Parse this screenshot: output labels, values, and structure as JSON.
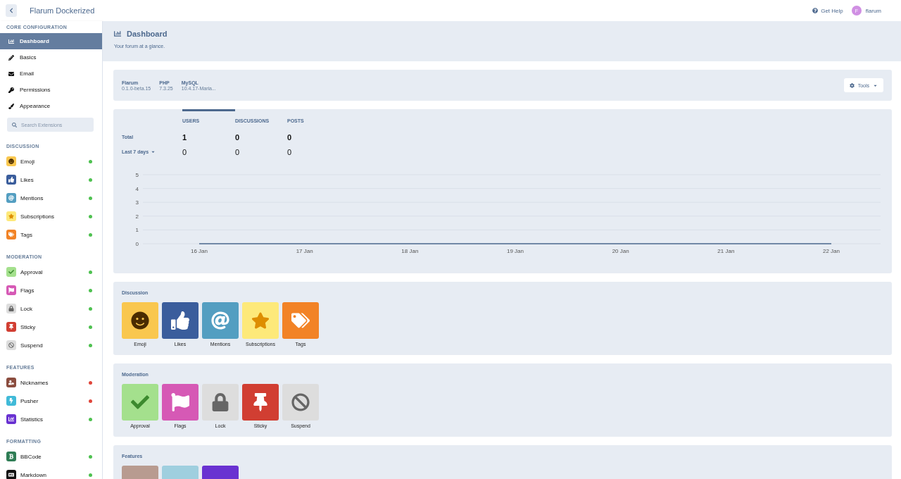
{
  "app": {
    "title": "Flarum Dockerized"
  },
  "header": {
    "help": "Get Help",
    "user": {
      "initial": "F",
      "name": "flarum"
    }
  },
  "sidebar": {
    "core_heading": "CORE CONFIGURATION",
    "core_items": [
      {
        "label": "Dashboard",
        "selected": true
      },
      {
        "label": "Basics",
        "selected": false
      },
      {
        "label": "Email",
        "selected": false
      },
      {
        "label": "Permissions",
        "selected": false
      },
      {
        "label": "Appearance",
        "selected": false
      }
    ],
    "search": {
      "placeholder": "Search Extensions"
    },
    "groups": [
      {
        "heading": "DISCUSSION",
        "items": [
          {
            "label": "Emoji",
            "color": "#4ec150"
          },
          {
            "label": "Likes",
            "color": "#4ec150"
          },
          {
            "label": "Mentions",
            "color": "#4ec150"
          },
          {
            "label": "Subscriptions",
            "color": "#4ec150"
          },
          {
            "label": "Tags",
            "color": "#4ec150"
          }
        ]
      },
      {
        "heading": "MODERATION",
        "items": [
          {
            "label": "Approval",
            "color": "#4ec150"
          },
          {
            "label": "Flags",
            "color": "#4ec150"
          },
          {
            "label": "Lock",
            "color": "#4ec150"
          },
          {
            "label": "Sticky",
            "color": "#4ec150"
          },
          {
            "label": "Suspend",
            "color": "#4ec150"
          }
        ]
      },
      {
        "heading": "FEATURES",
        "items": [
          {
            "label": "Nicknames",
            "color": "#e0453a"
          },
          {
            "label": "Pusher",
            "color": "#e0453a"
          },
          {
            "label": "Statistics",
            "color": "#4ec150"
          }
        ]
      },
      {
        "heading": "FORMATTING",
        "items": [
          {
            "label": "BBCode",
            "color": "#4ec150"
          },
          {
            "label": "Markdown",
            "color": "#4ec150"
          }
        ]
      }
    ]
  },
  "page": {
    "title": "Dashboard",
    "subtitle": "Your forum at a glance."
  },
  "status": {
    "items": [
      {
        "name": "Flarum",
        "value": "0.1.0-beta.15"
      },
      {
        "name": "PHP",
        "value": "7.3.25"
      },
      {
        "name": "MySQL",
        "value": "10.4.17-Maria..."
      }
    ],
    "tools": "Tools"
  },
  "statistics": {
    "columns": [
      {
        "label": "USERS",
        "selected": true
      },
      {
        "label": "DISCUSSIONS",
        "selected": false
      },
      {
        "label": "POSTS",
        "selected": false
      }
    ],
    "rows": [
      {
        "label": "Total",
        "kind": "total",
        "values": [
          "1",
          "0",
          "0"
        ]
      },
      {
        "label": "Last 7 days",
        "kind": "period",
        "values": [
          "0",
          "0",
          "0"
        ]
      }
    ],
    "chart_data": {
      "type": "line",
      "grid": true,
      "categories": [
        "16 Jan",
        "17 Jan",
        "18 Jan",
        "19 Jan",
        "20 Jan",
        "21 Jan",
        "22 Jan"
      ],
      "ylim": [
        0,
        5
      ],
      "yticks": [
        0,
        1,
        2,
        3,
        4,
        5
      ],
      "series": [
        {
          "color": "#4d698e",
          "values": [
            0,
            0,
            0,
            0,
            0,
            0,
            0
          ]
        }
      ]
    }
  },
  "widgets": [
    {
      "title": "Discussion",
      "tiles": [
        {
          "label": "Emoji",
          "color": "#f9c74f"
        },
        {
          "label": "Likes",
          "color": "#3a5d9c"
        },
        {
          "label": "Mentions",
          "color": "#539ec1"
        },
        {
          "label": "Subscriptions",
          "color": "#fde97a"
        },
        {
          "label": "Tags",
          "color": "#f28326"
        }
      ]
    },
    {
      "title": "Moderation",
      "tiles": [
        {
          "label": "Approval",
          "color": "#a4e08d"
        },
        {
          "label": "Flags",
          "color": "#d659b5"
        },
        {
          "label": "Lock",
          "color": "#dddddd"
        },
        {
          "label": "Sticky",
          "color": "#d13e32"
        },
        {
          "label": "Suspend",
          "color": "#dddddd"
        }
      ]
    },
    {
      "title": "Features",
      "tiles": [
        {
          "color": "#b89b90"
        },
        {
          "color": "#9fcfdf"
        },
        {
          "color": "#6932d1"
        }
      ]
    }
  ]
}
